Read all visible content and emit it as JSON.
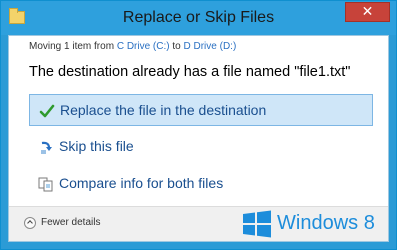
{
  "window": {
    "title": "Replace or Skip Files",
    "close_label": "✕"
  },
  "status": {
    "moving_prefix": "Moving 1 item from ",
    "source": "C Drive (C:)",
    "to_word": " to ",
    "destination": "D Drive (D:)"
  },
  "headline": "The destination already has a file named \"file1.txt\"",
  "options": [
    {
      "label": "Replace the file in the destination",
      "icon": "checkmark-icon",
      "selected": true
    },
    {
      "label": "Skip this file",
      "icon": "skip-arrow-icon",
      "selected": false
    },
    {
      "label": "Compare info for both files",
      "icon": "compare-files-icon",
      "selected": false
    }
  ],
  "footer": {
    "details_label": "Fewer details",
    "brand": "Windows 8"
  },
  "colors": {
    "accent": "#2ea0dd",
    "selected_bg": "#cfe6f8",
    "link": "#2a70c2",
    "close": "#c7433a"
  }
}
